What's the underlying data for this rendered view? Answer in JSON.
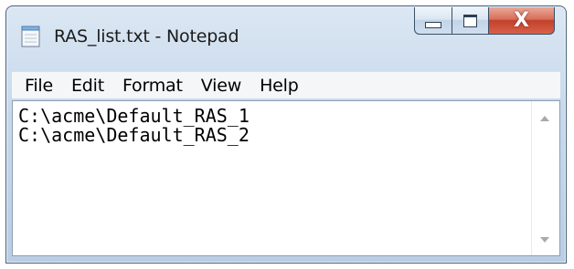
{
  "window": {
    "title": "RAS_list.txt - Notepad",
    "app_icon": "notepad-icon",
    "controls": {
      "minimize_icon": "minimize-icon",
      "maximize_icon": "maximize-icon",
      "close_icon": "close-icon",
      "close_glyph": "X"
    }
  },
  "menu": {
    "items": [
      "File",
      "Edit",
      "Format",
      "View",
      "Help"
    ]
  },
  "editor": {
    "lines": [
      "C:\\acme\\Default_RAS_1",
      "C:\\acme\\Default_RAS_2"
    ]
  },
  "scrollbar": {
    "up_icon": "scroll-up-arrow-icon",
    "down_icon": "scroll-down-arrow-icon"
  },
  "colors": {
    "title_bar": "#c8d9ec",
    "close_button": "#c2412a",
    "menu_bar": "#f5f6f7",
    "editor_bg": "#ffffff"
  }
}
